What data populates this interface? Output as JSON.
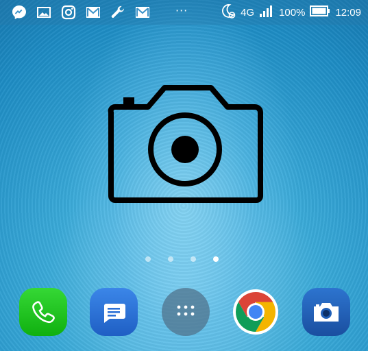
{
  "status_bar": {
    "notification_icons": [
      "messenger-icon",
      "gallery-icon",
      "instagram-icon",
      "gmail-icon",
      "wrench-icon",
      "gmail-icon"
    ],
    "more_indicator": "···",
    "network": "4G",
    "battery": "100%",
    "time": "12:09"
  },
  "home": {
    "page_count": 4,
    "active_page": 4
  },
  "dock": {
    "apps": [
      {
        "icon": "phone-icon",
        "color": "#1ec51e"
      },
      {
        "icon": "messages-icon",
        "color": "#2a6fd6"
      },
      {
        "icon": "app-drawer-icon",
        "color": "#5a7f98"
      },
      {
        "icon": "chrome-icon",
        "color": "#ffffff"
      },
      {
        "icon": "camera-icon",
        "color": "#1f5fb8"
      }
    ]
  },
  "colors": {
    "wallpaper": "#3aaad8",
    "status_bar_text": "#ffffff"
  }
}
